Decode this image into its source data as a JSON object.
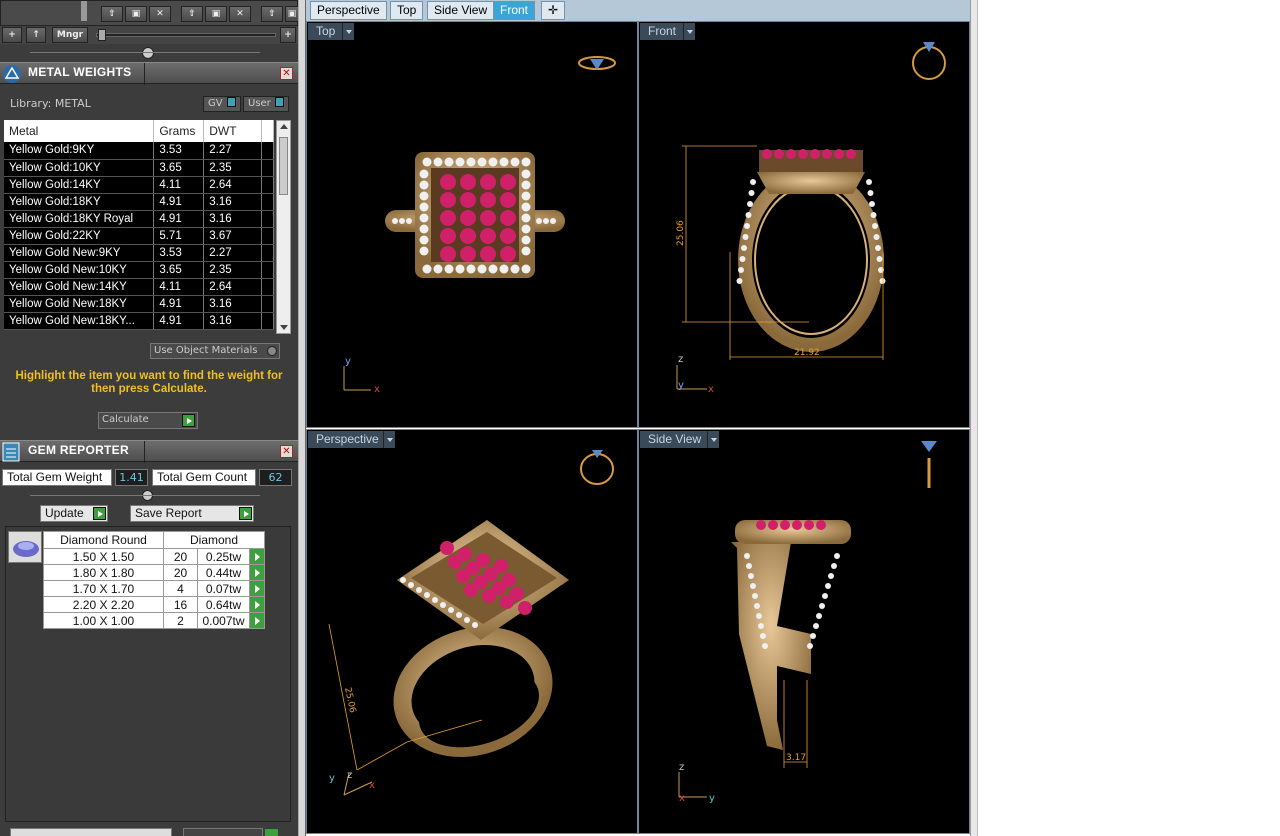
{
  "toolbar": {
    "mngr_label": "Mngr",
    "plus_label": "+",
    "add_label": "+",
    "up_label": "↑"
  },
  "metal_weights": {
    "title": "METAL WEIGHTS",
    "library_label": "Library: METAL",
    "gv_label": "GV",
    "user_label": "User",
    "columns": [
      "Metal",
      "Grams",
      "DWT"
    ],
    "rows": [
      {
        "metal": "Yellow Gold:9KY",
        "grams": "3.53",
        "dwt": "2.27"
      },
      {
        "metal": "Yellow Gold:10KY",
        "grams": "3.65",
        "dwt": "2.35"
      },
      {
        "metal": "Yellow Gold:14KY",
        "grams": "4.11",
        "dwt": "2.64"
      },
      {
        "metal": "Yellow Gold:18KY",
        "grams": "4.91",
        "dwt": "3.16"
      },
      {
        "metal": "Yellow Gold:18KY Royal",
        "grams": "4.91",
        "dwt": "3.16"
      },
      {
        "metal": "Yellow Gold:22KY",
        "grams": "5.71",
        "dwt": "3.67"
      },
      {
        "metal": "Yellow Gold New:9KY",
        "grams": "3.53",
        "dwt": "2.27"
      },
      {
        "metal": "Yellow Gold New:10KY",
        "grams": "3.65",
        "dwt": "2.35"
      },
      {
        "metal": "Yellow Gold New:14KY",
        "grams": "4.11",
        "dwt": "2.64"
      },
      {
        "metal": "Yellow Gold New:18KY",
        "grams": "4.91",
        "dwt": "3.16"
      },
      {
        "metal": "Yellow Gold New:18KY...",
        "grams": "4.91",
        "dwt": "3.16"
      }
    ],
    "use_object_materials": "Use Object Materials",
    "instructions": "Highlight the item you want to find the weight for then press Calculate.",
    "calculate_label": "Calculate"
  },
  "gem_reporter": {
    "title": "GEM REPORTER",
    "total_weight_label": "Total Gem Weight",
    "total_weight_value": "1.41",
    "total_count_label": "Total Gem Count",
    "total_count_value": "62",
    "update_label": "Update",
    "save_report_label": "Save Report",
    "columns": [
      "Diamond Round",
      "Diamond"
    ],
    "rows": [
      {
        "size": "1.50 X 1.50",
        "count": "20",
        "weight": "0.25tw"
      },
      {
        "size": "1.80 X 1.80",
        "count": "20",
        "weight": "0.44tw"
      },
      {
        "size": "1.70 X 1.70",
        "count": "4",
        "weight": "0.07tw"
      },
      {
        "size": "2.20 X 2.20",
        "count": "16",
        "weight": "0.64tw"
      },
      {
        "size": "1.00 X 1.00",
        "count": "2",
        "weight": "0.007tw"
      }
    ]
  },
  "viewport_tabs": [
    "Perspective",
    "Top",
    "Side View",
    "Front"
  ],
  "active_tab": "Front",
  "viewports": {
    "top": {
      "label": "Top",
      "axes": [
        "y",
        "x"
      ]
    },
    "front": {
      "label": "Front",
      "axes": [
        "z",
        "y",
        "x"
      ],
      "dim_height": "25.06",
      "dim_width": "21.92"
    },
    "perspective": {
      "label": "Perspective",
      "axes": [
        "y",
        "z",
        "x"
      ],
      "dim_height": "25.06"
    },
    "side": {
      "label": "Side View",
      "axes": [
        "z",
        "x",
        "y"
      ],
      "dim_width": "3.17"
    }
  },
  "colors": {
    "gold": "#c8a06a",
    "ruby": "#d0206a",
    "diamond": "#f0f0f0",
    "dimension": "#e6a030",
    "active_tab": "#3aa6d8"
  }
}
